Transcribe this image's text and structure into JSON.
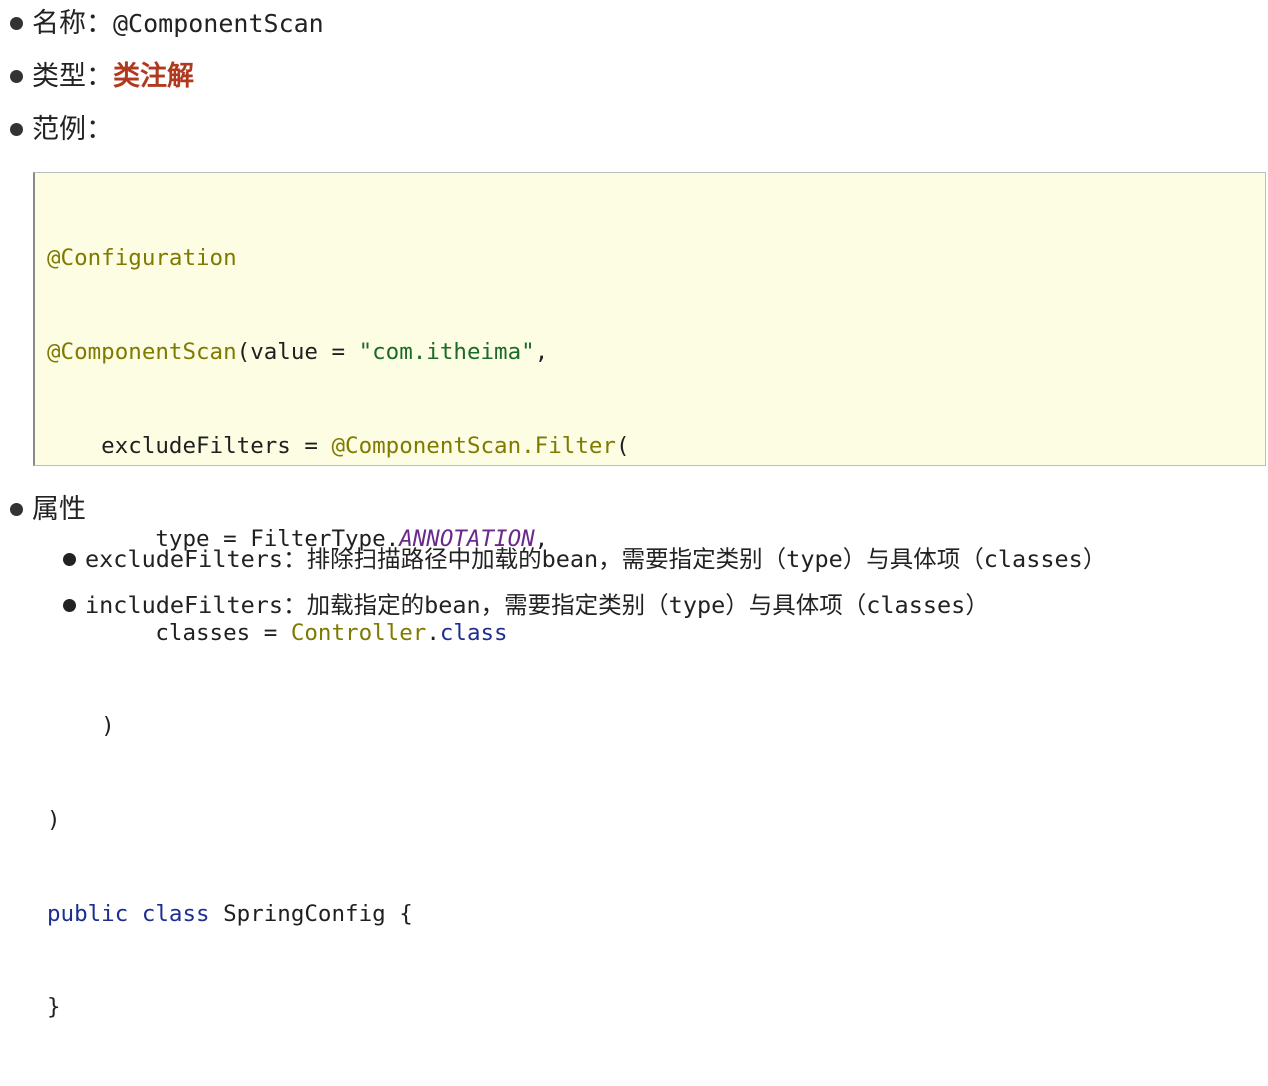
{
  "items": {
    "name": {
      "label": "名称：",
      "value": "@ComponentScan"
    },
    "type": {
      "label": "类型：",
      "value": "类注解"
    },
    "example": {
      "label": "范例："
    }
  },
  "code": {
    "line1": "@Configuration",
    "line2_ann": "@ComponentScan",
    "line2_rest1": "(value = ",
    "line2_str": "\"com.itheima\"",
    "line2_rest2": ",",
    "line3_indent": "    excludeFilters = ",
    "line3_ann": "@ComponentScan.Filter",
    "line3_rest": "(",
    "line4_indent": "        type = FilterType.",
    "line4_italic": "ANNOTATION",
    "line4_rest": ",",
    "line5_indent": "        classes = ",
    "line5_ann": "Controller",
    "line5_dot": ".",
    "line5_kw": "class",
    "line6": "    )",
    "line7": ")",
    "line8_kw": "public class",
    "line8_rest": " SpringConfig {",
    "line9": "}"
  },
  "attributes": {
    "label": "属性",
    "entries": [
      {
        "key": "excludeFilters",
        "sep": "：",
        "desc_a": "排除扫描路径中加载的",
        "desc_bean": "bean",
        "desc_b": "，需要指定类别（",
        "desc_type": "type",
        "desc_c": "）与具体项（",
        "desc_classes": "classes",
        "desc_d": "）"
      },
      {
        "key": "includeFilters",
        "sep": "：",
        "desc_a": "加载指定的",
        "desc_bean": "bean",
        "desc_b": "，需要指定类别（",
        "desc_type": "type",
        "desc_c": "）与具体项（",
        "desc_classes": "classes",
        "desc_d": "）"
      }
    ]
  },
  "colors": {
    "type_value": "#b03a1f",
    "code_background": "#fdfde4",
    "annotation": "#7f7a00",
    "string": "#1a6b2a",
    "keyword": "#1c2f91",
    "enum_constant": "#6a2a8a"
  }
}
